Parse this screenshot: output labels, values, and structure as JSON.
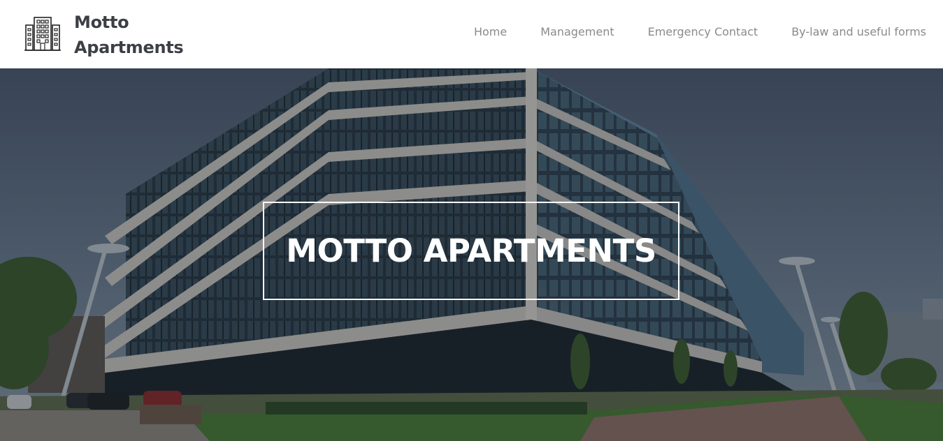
{
  "brand": {
    "logo_icon": "apartment-building-icon",
    "name_line1": "Motto",
    "name_line2": "Apartments"
  },
  "nav": {
    "items": [
      {
        "label": "Home"
      },
      {
        "label": "Management"
      },
      {
        "label": "Emergency Contact"
      },
      {
        "label": "By-law and useful forms"
      }
    ]
  },
  "hero": {
    "title": "MOTTO APARTMENTS",
    "background": "modern-apartment-building-photo"
  },
  "colors": {
    "brand_text": "#3c3f45",
    "nav_text": "#8a8a8a",
    "hero_title": "#ffffff",
    "header_bg": "#ffffff"
  }
}
